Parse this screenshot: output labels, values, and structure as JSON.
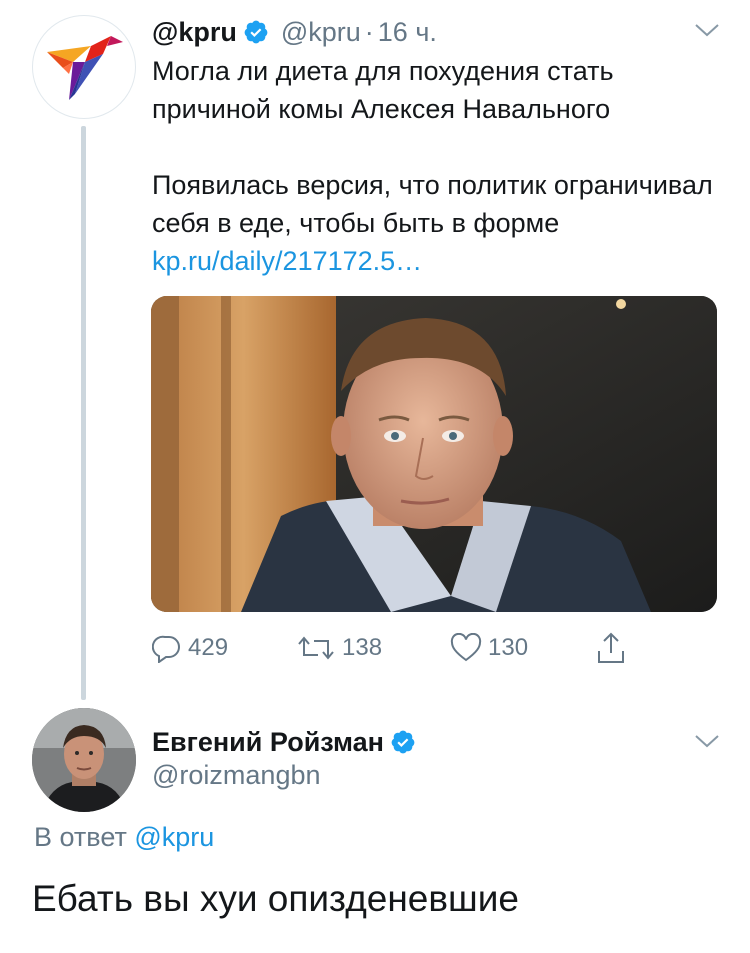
{
  "parent_tweet": {
    "display_name": "@kpru",
    "handle": "@kpru",
    "separator": "·",
    "time": "16 ч.",
    "text_line1": "Могла ли диета для похудения стать причиной комы Алексея Навального",
    "text_line2": "Появилась версия, что политик ограничивал себя в еде, чтобы быть в форме",
    "link": "kp.ru/daily/217172.5…",
    "actions": {
      "reply_count": "429",
      "retweet_count": "138",
      "like_count": "130"
    }
  },
  "reply_tweet": {
    "display_name": "Евгений Ройзман",
    "handle": "@roizmangbn",
    "in_reply_to_prefix": "В ответ",
    "in_reply_to_handle": "@kpru",
    "text": "Ебать вы хуи опизденевшие"
  },
  "colors": {
    "link": "#1b95e0",
    "secondary_text": "#657786",
    "primary_text": "#14171a",
    "verified": "#1da1f2",
    "thread_line": "#ccd6dd"
  },
  "icons": [
    "kp-logo-icon",
    "verified-badge-icon",
    "caret-down-icon",
    "reply-icon",
    "retweet-icon",
    "like-icon",
    "share-icon"
  ]
}
